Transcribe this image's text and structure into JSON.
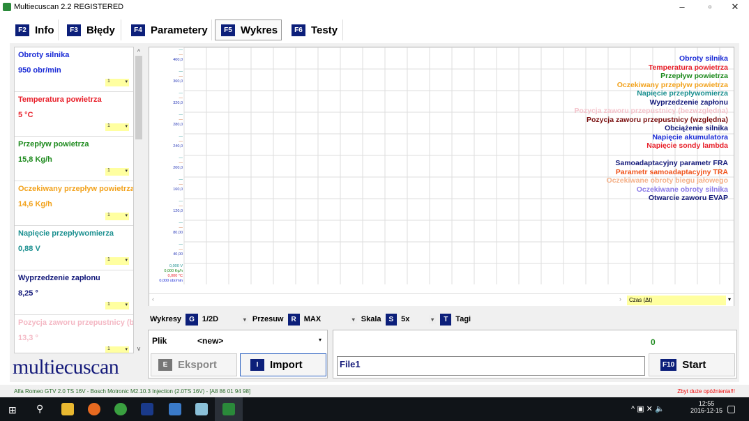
{
  "window": {
    "title": "Multiecuscan 2.2 REGISTERED"
  },
  "tabs": [
    {
      "key": "F2",
      "label": "Info"
    },
    {
      "key": "F3",
      "label": "Błędy"
    },
    {
      "key": "F4",
      "label": "Parametery"
    },
    {
      "key": "F5",
      "label": "Wykres"
    },
    {
      "key": "F6",
      "label": "Testy"
    }
  ],
  "params": [
    {
      "name": "Obroty silnika",
      "value": "950 obr/min",
      "color": "#1a2bd6",
      "sel": "1"
    },
    {
      "name": "Temperatura powietrza",
      "value": "5 °C",
      "color": "#e8202a",
      "sel": "1"
    },
    {
      "name": "Przepływ powietrza",
      "value": "15,8 Kg/h",
      "color": "#1d8a1d",
      "sel": "1"
    },
    {
      "name": "Oczekiwany przepływ powietrza",
      "value": "14,6 Kg/h",
      "color": "#f2a21c",
      "sel": "1"
    },
    {
      "name": "Napięcie przepływomierza",
      "value": "0,88 V",
      "color": "#1a8f8f",
      "sel": "1"
    },
    {
      "name": "Wyprzedzenie zapłonu",
      "value": "8,25 °",
      "color": "#141a7a",
      "sel": "1"
    },
    {
      "name": "Pozycja zaworu przepustnicy (bezwzględna)",
      "value": "13,3 °",
      "color": "#f4b8c4",
      "sel": "1"
    }
  ],
  "legend": [
    {
      "text": "Obroty silnika",
      "color": "#1a2bd6"
    },
    {
      "text": "Temperatura powietrza",
      "color": "#e8202a"
    },
    {
      "text": "Przepływ powietrza",
      "color": "#1d8a1d"
    },
    {
      "text": "Oczekiwany przepływ powietrza",
      "color": "#f2a21c"
    },
    {
      "text": "Napięcie przepływomierza",
      "color": "#1a8f8f"
    },
    {
      "text": "Wyprzedzenie zapłonu",
      "color": "#141a7a"
    },
    {
      "text": "Pozycja zaworu przepustnicy (bezwzględna)",
      "color": "#f4c4cc"
    },
    {
      "text": "Pozycja zaworu przepustnicy (względna)",
      "color": "#7a1010"
    },
    {
      "text": "Obciążenie silnika",
      "color": "#141a7a"
    },
    {
      "text": "Napięcie akumulatora",
      "color": "#1a2bd6"
    },
    {
      "text": "Napięcie sondy lambda",
      "color": "#e8202a"
    },
    {
      "text": " ",
      "color": "#fff"
    },
    {
      "text": "Samoadaptacyjny parametr FRA",
      "color": "#141a7a"
    },
    {
      "text": "Parametr samoadaptacyjny TRA",
      "color": "#f0541c"
    },
    {
      "text": "Oczekiwane obroty biegu jałowego",
      "color": "#f4b088"
    },
    {
      "text": "Oczekiwane obroty silnika",
      "color": "#8a7ae8"
    },
    {
      "text": "Otwarcie zaworu EVAP",
      "color": "#141a7a"
    }
  ],
  "yaxis": {
    "ticks": [
      "400,0",
      "360,0",
      "320,0",
      "280,0",
      "240,0",
      "200,0",
      "160,0",
      "120,0",
      "80,00",
      "40,00"
    ],
    "bottom": [
      {
        "t": "0,000 V",
        "c": "#1a8f8f"
      },
      {
        "t": "0,000 Kg/h",
        "c": "#1d8a1d"
      },
      {
        "t": "0,000 °C",
        "c": "#e8202a"
      },
      {
        "t": "0,000 obr/min",
        "c": "#1a2bd6"
      }
    ]
  },
  "xaxis": {
    "label": "Czas (Δt)"
  },
  "controls": {
    "wykresy": "Wykresy",
    "g": "G",
    "wykresy_val": "1/2D",
    "przesuw": "Przesuw",
    "r": "R",
    "przesuw_val": "MAX",
    "skala": "Skala",
    "s": "S",
    "skala_val": "5x",
    "t": "T",
    "tagi": "Tagi"
  },
  "file": {
    "label": "Plik",
    "value": "<new>",
    "counter": "0",
    "name": "File1"
  },
  "buttons": {
    "export_key": "E",
    "export": "Eksport",
    "import_key": "I",
    "import": "Import",
    "start_key": "F10",
    "start": "Start"
  },
  "logo": "multiecuscan",
  "status": {
    "vehicle": "Alfa Romeo GTV 2.0 TS 16V - Bosch Motronic M2.10.3 Injection (2.0TS 16V) - [A8 86 01 94 98]",
    "warning": "Zbyt duże opóźnienia!!!"
  },
  "taskbar": {
    "time": "12:55",
    "date": "2016-12-15"
  }
}
